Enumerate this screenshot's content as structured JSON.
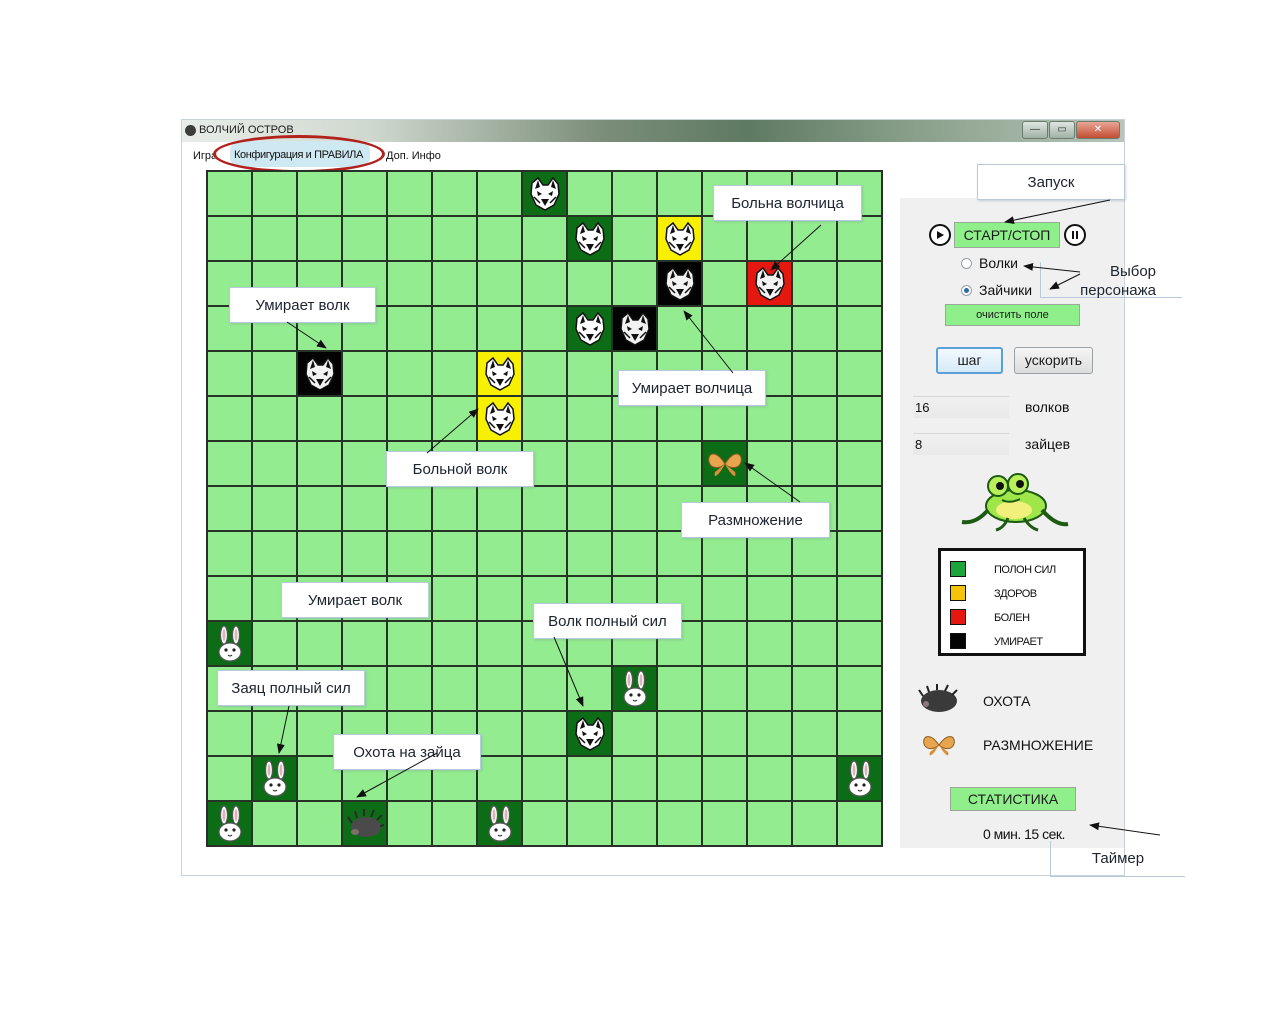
{
  "window": {
    "title": "ВОЛЧИЙ ОСТРОВ",
    "buttons": {
      "minimize": "—",
      "maximize": "▭",
      "close": "✕"
    }
  },
  "menu": {
    "items": [
      "Игра",
      "Конфигурация и ПРАВИЛА",
      "Доп. Инфо"
    ]
  },
  "board": {
    "rows": 15,
    "cols": 15,
    "cells": [
      {
        "r": 0,
        "c": 7,
        "state": "dark",
        "piece": "wolf"
      },
      {
        "r": 1,
        "c": 8,
        "state": "dark",
        "piece": "wolf"
      },
      {
        "r": 1,
        "c": 10,
        "state": "yellow",
        "piece": "wolf"
      },
      {
        "r": 2,
        "c": 10,
        "state": "black",
        "piece": "wolf"
      },
      {
        "r": 2,
        "c": 12,
        "state": "red",
        "piece": "wolf"
      },
      {
        "r": 3,
        "c": 8,
        "state": "dark",
        "piece": "wolf"
      },
      {
        "r": 3,
        "c": 9,
        "state": "black",
        "piece": "wolf"
      },
      {
        "r": 4,
        "c": 2,
        "state": "black",
        "piece": "wolf"
      },
      {
        "r": 4,
        "c": 6,
        "state": "yellow",
        "piece": "wolf"
      },
      {
        "r": 5,
        "c": 6,
        "state": "yellow",
        "piece": "wolf"
      },
      {
        "r": 6,
        "c": 11,
        "state": "dark",
        "piece": "butterfly"
      },
      {
        "r": 10,
        "c": 0,
        "state": "dark",
        "piece": "rabbit"
      },
      {
        "r": 11,
        "c": 9,
        "state": "dark",
        "piece": "rabbit"
      },
      {
        "r": 12,
        "c": 8,
        "state": "dark",
        "piece": "wolf"
      },
      {
        "r": 13,
        "c": 1,
        "state": "dark",
        "piece": "rabbit"
      },
      {
        "r": 13,
        "c": 14,
        "state": "dark",
        "piece": "rabbit"
      },
      {
        "r": 14,
        "c": 0,
        "state": "dark",
        "piece": "rabbit"
      },
      {
        "r": 14,
        "c": 3,
        "state": "dark",
        "piece": "hedgehog"
      },
      {
        "r": 14,
        "c": 6,
        "state": "dark",
        "piece": "rabbit"
      }
    ]
  },
  "panel": {
    "start_stop": "СТАРТ/СТОП",
    "play_icon": "play-icon",
    "pause_icon": "pause-icon",
    "radio_wolves": "Волки",
    "radio_rabbits": "Зайчики",
    "selected_radio": "Зайчики",
    "clear_field": "очистить поле",
    "step": "шаг",
    "speed_up": "ускорить",
    "wolves_count": "16",
    "wolves_label": "волков",
    "rabbits_count": "8",
    "rabbits_label": "зайцев",
    "frog_icon": "frog-icon",
    "legend": [
      {
        "color": "#1ba53a",
        "label": "ПОЛОН СИЛ"
      },
      {
        "color": "#f5c30a",
        "label": "ЗДОРОВ"
      },
      {
        "color": "#e5180f",
        "label": "БОЛЕН"
      },
      {
        "color": "#030303",
        "label": "УМИРАЕТ"
      }
    ],
    "hunt_label": "ОХОТА",
    "breeding_label": "РАЗМНОЖЕНИЕ",
    "statistics": "СТАТИСТИКА",
    "timer": "0 мин. 15 сек."
  },
  "callouts": {
    "launch": "Запуск",
    "sick_she_wolf": "Больна волчица",
    "choose_line1": "Выбор",
    "choose_line2": "персонажа",
    "wolf_dies_1": "Умирает волк",
    "she_wolf_dies": "Умирает волчица",
    "sick_wolf": "Больной волк",
    "breeding": "Размножение",
    "wolf_dies_2": "Умирает волк",
    "wolf_full": "Волк полный сил",
    "rabbit_full": "Заяц полный сил",
    "hunt_rabbit": "Охота на зайца",
    "timer": "Таймер"
  },
  "colors": {
    "cell_empty": "#93ec8f",
    "cell_full": "#0c6d16",
    "cell_healthy": "#f7f000",
    "cell_sick": "#e5180f",
    "cell_dying": "#030303",
    "annotation_ring": "#b0221b"
  }
}
